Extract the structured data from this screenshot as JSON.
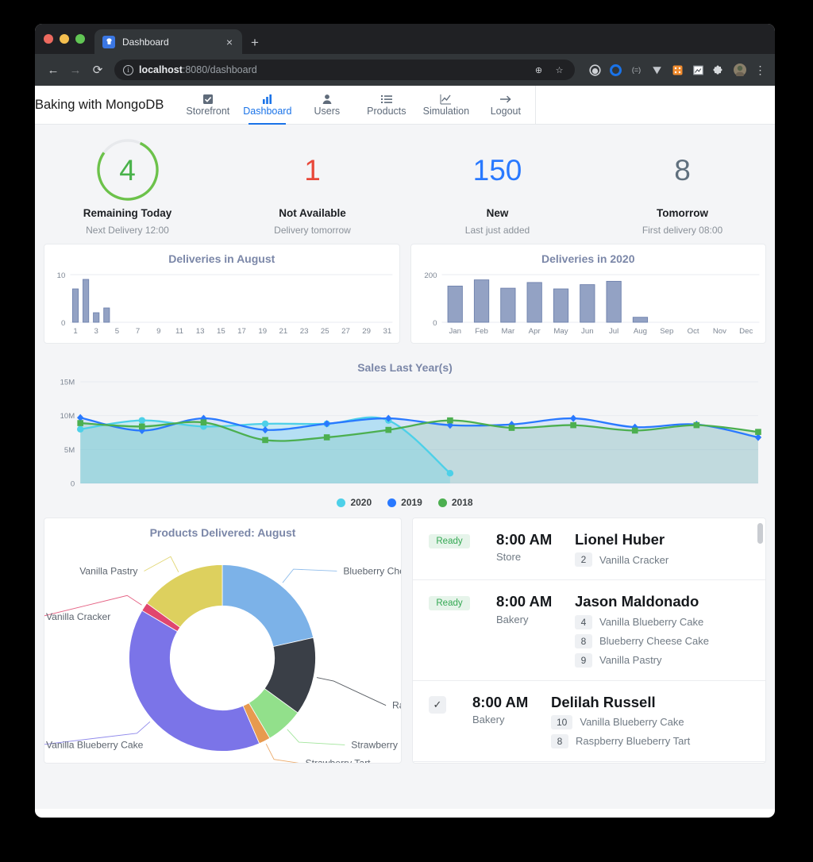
{
  "browser": {
    "tab_title": "Dashboard",
    "close_label": "×",
    "newtab_label": "+",
    "back_icon": "←",
    "forward_icon": "→",
    "reload_icon": "⟳",
    "url_host": "localhost",
    "url_rest": ":8080/dashboard",
    "info_icon": "i",
    "zoom_icon": "⊕",
    "bookmark_icon": "☆",
    "menu_icon": "⋮",
    "extensions": [
      "●",
      "○",
      "(=)",
      "▼",
      "■",
      "▤",
      "❉",
      "●"
    ]
  },
  "app": {
    "brand": "Baking with MongoDB",
    "nav": [
      {
        "label": "Storefront",
        "icon": "☑",
        "active": false
      },
      {
        "label": "Dashboard",
        "icon": "Ὄa",
        "active": true
      },
      {
        "label": "Users",
        "icon": "὆4",
        "active": false
      },
      {
        "label": "Products",
        "icon": "☰",
        "active": false
      },
      {
        "label": "Simulation",
        "icon": "Ὄ8",
        "active": false
      },
      {
        "label": "Logout",
        "icon": "→",
        "active": false
      }
    ]
  },
  "kpis": [
    {
      "value": "4",
      "title": "Remaining Today",
      "sub": "Next Delivery 12:00",
      "color": "#49b24a",
      "ring": true,
      "ring_pct": 78
    },
    {
      "value": "1",
      "title": "Not Available",
      "sub": "Delivery tomorrow",
      "color": "#e8483a",
      "ring": false
    },
    {
      "value": "150",
      "title": "New",
      "sub": "Last just added",
      "color": "#2979ff",
      "ring": false
    },
    {
      "value": "8",
      "title": "Tomorrow",
      "sub": "First delivery 08:00",
      "color": "#60707e",
      "ring": false
    }
  ],
  "chart_data": [
    {
      "type": "bar",
      "title": "Deliveries in August",
      "categories": [
        "1",
        "2",
        "3",
        "4",
        "5",
        "6",
        "7",
        "8",
        "9",
        "10",
        "11",
        "12",
        "13",
        "14",
        "15",
        "16",
        "17",
        "18",
        "19",
        "20",
        "21",
        "22",
        "23",
        "24",
        "25",
        "26",
        "27",
        "28",
        "29",
        "30",
        "31"
      ],
      "tick_labels": [
        "1",
        "3",
        "5",
        "7",
        "9",
        "11",
        "13",
        "15",
        "17",
        "19",
        "21",
        "23",
        "25",
        "27",
        "29",
        "31"
      ],
      "values": [
        7,
        9,
        2,
        3,
        0,
        0,
        0,
        0,
        0,
        0,
        0,
        0,
        0,
        0,
        0,
        0,
        0,
        0,
        0,
        0,
        0,
        0,
        0,
        0,
        0,
        0,
        0,
        0,
        0,
        0,
        0
      ],
      "ylim": [
        0,
        10
      ],
      "yticks": [
        "0",
        "10"
      ],
      "xlabel": "",
      "ylabel": "",
      "bar_color": "#93a2c4",
      "bar_border": "#6f82ad",
      "grid": true
    },
    {
      "type": "bar",
      "title": "Deliveries in 2020",
      "categories": [
        "Jan",
        "Feb",
        "Mar",
        "Apr",
        "May",
        "Jun",
        "Jul",
        "Aug",
        "Sep",
        "Oct",
        "Nov",
        "Dec"
      ],
      "values": [
        152,
        178,
        143,
        167,
        140,
        158,
        172,
        21,
        0,
        0,
        0,
        0
      ],
      "ylim": [
        0,
        200
      ],
      "yticks": [
        "0",
        "200"
      ],
      "xlabel": "",
      "ylabel": "",
      "bar_color": "#93a2c4",
      "bar_border": "#6f82ad",
      "grid": true
    },
    {
      "type": "line",
      "title": "Sales Last Year(s)",
      "x": [
        "1",
        "2",
        "3",
        "4",
        "5",
        "6",
        "7",
        "8",
        "9",
        "10",
        "11",
        "12"
      ],
      "ylim": [
        0,
        15000000
      ],
      "yticks": [
        "0",
        "5M",
        "10M",
        "15M"
      ],
      "legend_position": "bottom",
      "series": [
        {
          "name": "2020",
          "color": "#4dd0e8",
          "marker": "circle",
          "values": [
            8000000,
            9300000,
            8400000,
            8800000,
            8800000,
            9300000,
            1500000,
            null,
            null,
            null,
            null,
            null
          ]
        },
        {
          "name": "2019",
          "color": "#2979ff",
          "marker": "diamond",
          "values": [
            9700000,
            7800000,
            9600000,
            7900000,
            8800000,
            9600000,
            8600000,
            8700000,
            9600000,
            8300000,
            8700000,
            6800000
          ]
        },
        {
          "name": "2018",
          "color": "#4caf50",
          "marker": "square",
          "values": [
            8900000,
            8400000,
            9000000,
            6400000,
            6800000,
            7900000,
            9300000,
            8200000,
            8600000,
            7800000,
            8600000,
            7600000
          ]
        }
      ]
    },
    {
      "type": "pie",
      "title": "Products Delivered: August",
      "labels": [
        "Blueberry Cheese Cake",
        "Raspberry Blueberry Tart",
        "Strawberry Bun",
        "Strawberry Tart",
        "Vanilla Blueberry Cake",
        "Vanilla Cracker",
        "Vanilla Pastry"
      ],
      "values": [
        21.5,
        13.5,
        6.5,
        2.0,
        40.0,
        1.5,
        15.0
      ],
      "colors": [
        "#7cb2e8",
        "#3a3f47",
        "#92e08b",
        "#e79a4f",
        "#7b74e8",
        "#e0466e",
        "#ddd05e"
      ]
    }
  ],
  "deliveries": {
    "scrollbar": true,
    "rows": [
      {
        "status": "Ready",
        "checked": false,
        "time": "8:00 AM",
        "place": "Store",
        "name": "Lionel Huber",
        "items": [
          {
            "qty": "2",
            "name": "Vanilla Cracker"
          }
        ]
      },
      {
        "status": "Ready",
        "checked": false,
        "time": "8:00 AM",
        "place": "Bakery",
        "name": "Jason Maldonado",
        "items": [
          {
            "qty": "4",
            "name": "Vanilla Blueberry Cake"
          },
          {
            "qty": "8",
            "name": "Blueberry Cheese Cake"
          },
          {
            "qty": "9",
            "name": "Vanilla Pastry"
          }
        ]
      },
      {
        "status": "",
        "checked": true,
        "check_icon": "✓",
        "time": "8:00 AM",
        "place": "Bakery",
        "name": "Delilah Russell",
        "items": [
          {
            "qty": "10",
            "name": "Vanilla Blueberry Cake"
          },
          {
            "qty": "8",
            "name": "Raspberry Blueberry Tart"
          }
        ]
      }
    ]
  }
}
